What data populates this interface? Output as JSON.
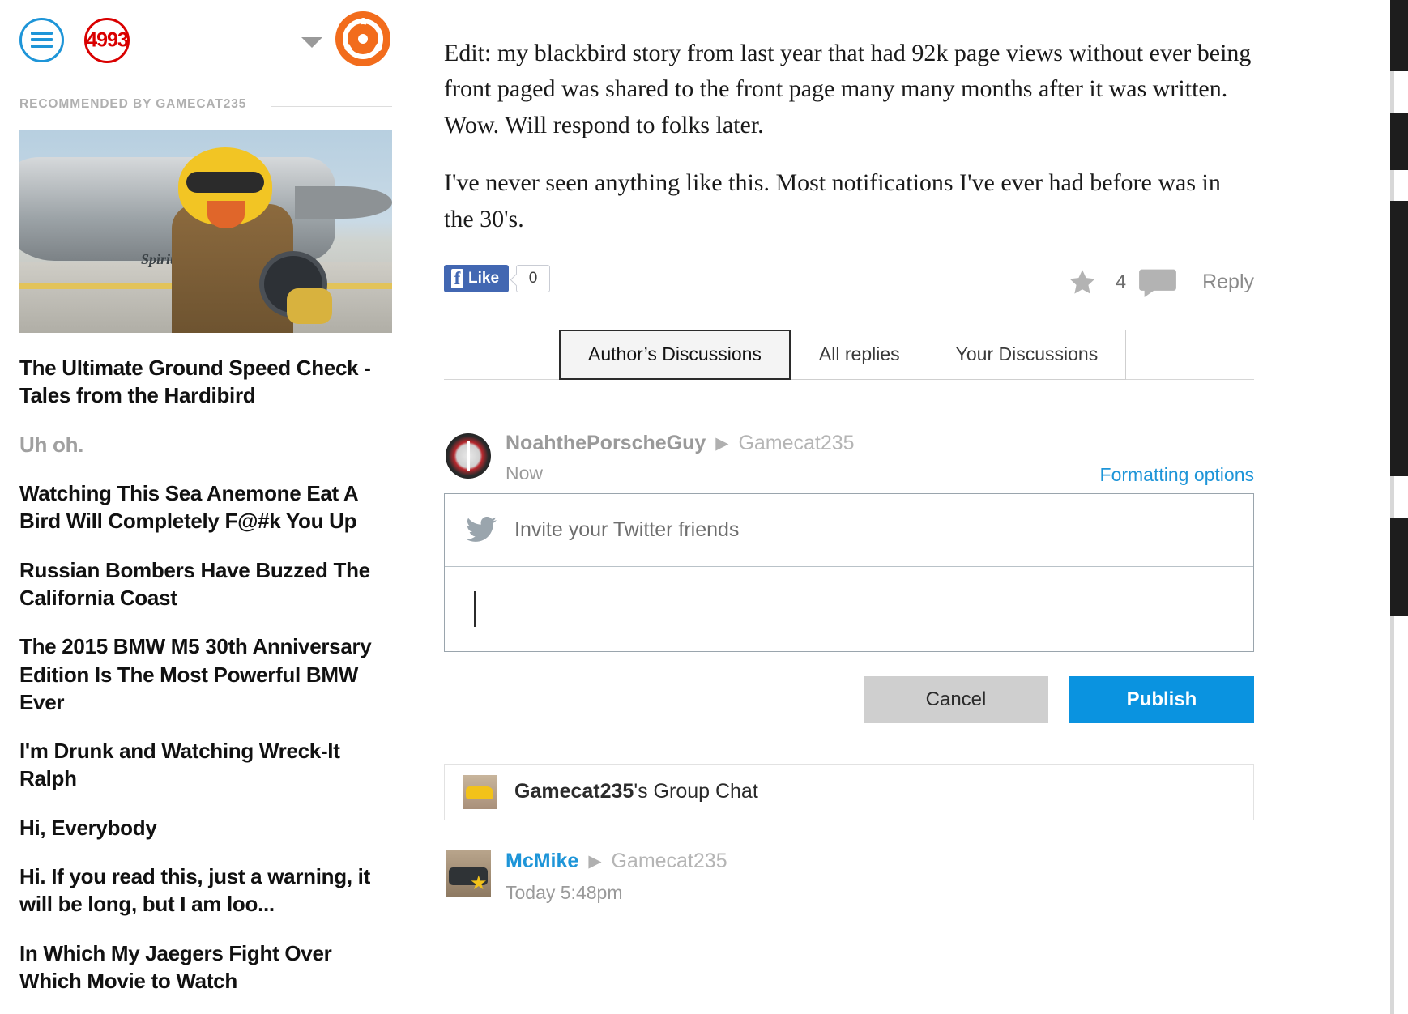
{
  "toolbar": {
    "menu_icon": "hamburger-icon",
    "notification_count": "4993",
    "dropdown_icon": "chevron-down-icon",
    "avatar_icon": "steering-wheel-avatar"
  },
  "sidebar": {
    "section_label": "RECOMMENDED BY GAMECAT235",
    "featured": {
      "image_caption": "Spirit of LeMons",
      "title": "The Ultimate Ground Speed Check - Tales from the Hardibird"
    },
    "items": [
      {
        "title": "Uh oh.",
        "muted": true
      },
      {
        "title": "Watching This Sea Anemone Eat A Bird Will Completely F@#k You Up",
        "muted": false
      },
      {
        "title": "Russian Bombers Have Buzzed The California Coast",
        "muted": false
      },
      {
        "title": "The 2015 BMW M5 30th Anniversary Edition Is The Most Powerful BMW Ever",
        "muted": false
      },
      {
        "title": "I'm Drunk and Watching Wreck-It Ralph",
        "muted": false
      },
      {
        "title": "Hi, Everybody",
        "muted": false
      },
      {
        "title": "Hi. If you read this, just a warning, it will be long, but I am loo...",
        "muted": false
      },
      {
        "title": "In Which My Jaegers Fight Over Which Movie to Watch",
        "muted": false
      }
    ]
  },
  "post": {
    "paragraphs": [
      "Edit: my blackbird story from last year that had 92k page views without ever being front paged was shared to the front page many many months after it was written. Wow. Will respond to folks later.",
      "I've never seen anything like this. Most notifications I've ever had before was in the 30's."
    ]
  },
  "actions": {
    "facebook_label": "Like",
    "facebook_count": "0",
    "star_icon": "star-icon",
    "reply_count": "4",
    "comment_icon": "speech-bubble-icon",
    "reply_label": "Reply"
  },
  "tabs": [
    {
      "label": "Author’s Discussions",
      "active": true
    },
    {
      "label": "All replies",
      "active": false
    },
    {
      "label": "Your Discussions",
      "active": false
    }
  ],
  "composer": {
    "author": "NoahthePorscheGuy",
    "arrow": "▶",
    "target": "Gamecat235",
    "timestamp": "Now",
    "formatting_link": "Formatting options",
    "twitter_icon": "twitter-bird-icon",
    "twitter_invite": "Invite your Twitter friends",
    "input_value": "",
    "input_placeholder": "",
    "cancel_label": "Cancel",
    "publish_label": "Publish"
  },
  "group_chat": {
    "owner": "Gamecat235",
    "suffix": "'s Group Chat"
  },
  "reply_item": {
    "author": "McMike",
    "arrow": "▶",
    "target": "Gamecat235",
    "timestamp": "Today 5:48pm"
  },
  "colors": {
    "accent_blue": "#1e95d8",
    "publish_blue": "#0a93e0",
    "notification_red": "#d90000",
    "avatar_orange": "#f26c1c",
    "facebook_blue": "#4267b2"
  }
}
